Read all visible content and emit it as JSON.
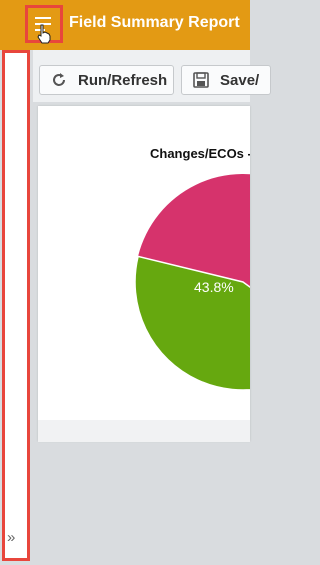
{
  "header": {
    "title": "Field Summary Report",
    "menu_icon": "menu-toggle-icon",
    "background": "#e39a14"
  },
  "toolbar": {
    "run_label": "Run/Refresh",
    "save_label": "Save/"
  },
  "sidebar": {
    "expand_glyph": "»"
  },
  "chart_data": {
    "type": "pie",
    "title": "Changes/ECOs -",
    "slices": [
      {
        "value": 43.8,
        "label": "43.8%",
        "color": "#66a80f"
      },
      {
        "value": null,
        "label": "",
        "color": "#d6336c"
      }
    ]
  },
  "highlight_color": "#e8463c"
}
